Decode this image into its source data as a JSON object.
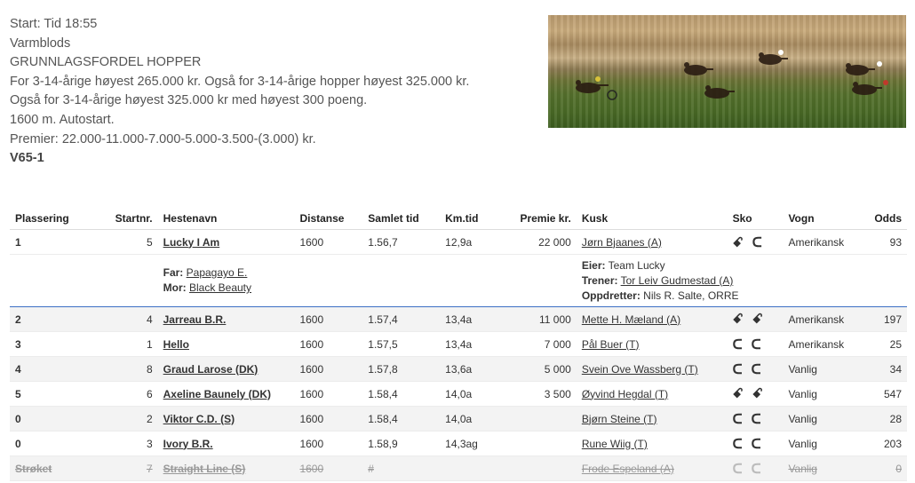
{
  "info": {
    "start": "Start: Tid 18:55",
    "type": "Varmblods",
    "race_name": "GRUNNLAGSFORDEL HOPPER",
    "cond1": "For 3-14-årige høyest 265.000 kr. Også for 3-14-årige hopper høyest 325.000 kr.",
    "cond2": "Også for 3-14-årige høyest 325.000 kr med høyest 300 poeng.",
    "distance": "1600 m. Autostart.",
    "prizes": "Premier: 22.000-11.000-7.000-5.000-3.500-(3.000) kr.",
    "game": "V65-1"
  },
  "table": {
    "headers": {
      "place": "Plassering",
      "startnr": "Startnr.",
      "horse": "Hestenavn",
      "distance": "Distanse",
      "total": "Samlet tid",
      "km": "Km.tid",
      "prize": "Premie kr.",
      "driver": "Kusk",
      "shoe": "Sko",
      "cart": "Vogn",
      "odds": "Odds"
    },
    "rows": [
      {
        "place": "1",
        "nr": "5",
        "horse": "Lucky I Am",
        "dist": "1600",
        "total": "1.56,7",
        "km": "12,9a",
        "prize": "22 000",
        "driver": "Jørn Bjaanes (A)",
        "shoe": "ꗃ ᑕ",
        "cart": "Amerikansk",
        "odds": "93"
      },
      {
        "place": "2",
        "nr": "4",
        "horse": "Jarreau B.R.",
        "dist": "1600",
        "total": "1.57,4",
        "km": "13,4a",
        "prize": "11 000",
        "driver": "Mette H. Mæland (A)",
        "shoe": "ꗃ ꗃ",
        "cart": "Amerikansk",
        "odds": "197"
      },
      {
        "place": "3",
        "nr": "1",
        "horse": "Hello",
        "dist": "1600",
        "total": "1.57,5",
        "km": "13,4a",
        "prize": "7 000",
        "driver": "Pål Buer (T)",
        "shoe": "ᑕ ᑕ",
        "cart": "Amerikansk",
        "odds": "25"
      },
      {
        "place": "4",
        "nr": "8",
        "horse": "Graud Larose (DK)",
        "dist": "1600",
        "total": "1.57,8",
        "km": "13,6a",
        "prize": "5 000",
        "driver": "Svein Ove Wassberg (T)",
        "shoe": "ᑕ ᑕ",
        "cart": "Vanlig",
        "odds": "34"
      },
      {
        "place": "5",
        "nr": "6",
        "horse": "Axeline Baunely (DK)",
        "dist": "1600",
        "total": "1.58,4",
        "km": "14,0a",
        "prize": "3 500",
        "driver": "Øyvind Hegdal (T)",
        "shoe": "ꗃ ꗃ",
        "cart": "Vanlig",
        "odds": "547"
      },
      {
        "place": "0",
        "nr": "2",
        "horse": "Viktor C.D. (S)",
        "dist": "1600",
        "total": "1.58,4",
        "km": "14,0a",
        "prize": "",
        "driver": "Bjørn Steine (T)",
        "shoe": "ᑕ ᑕ",
        "cart": "Vanlig",
        "odds": "28"
      },
      {
        "place": "0",
        "nr": "3",
        "horse": "Ivory B.R.",
        "dist": "1600",
        "total": "1.58,9",
        "km": "14,3ag",
        "prize": "",
        "driver": "Rune Wiig (T)",
        "shoe": "ᑕ ᑕ",
        "cart": "Vanlig",
        "odds": "203"
      },
      {
        "place": "Strøket",
        "nr": "7",
        "horse": "Straight Line (S)",
        "dist": "1600",
        "total": "#",
        "km": "",
        "prize": "",
        "driver": "Frode Espeland (A)",
        "shoe": "ᑕ ᑕ",
        "cart": "Vanlig",
        "odds": "0"
      }
    ],
    "detail": {
      "far_label": "Far:",
      "far": "Papagayo E.",
      "mor_label": "Mor:",
      "mor": "Black Beauty",
      "eier_label": "Eier:",
      "eier": "Team Lucky",
      "trener_label": "Trener:",
      "trener": "Tor Leiv Gudmestad (A)",
      "oppdretter_label": "Oppdretter:",
      "oppdretter": "Nils R. Salte, ORRE"
    }
  },
  "colors": {
    "separator": "#3c6fc4",
    "alt_row": "#f3f3f3"
  }
}
